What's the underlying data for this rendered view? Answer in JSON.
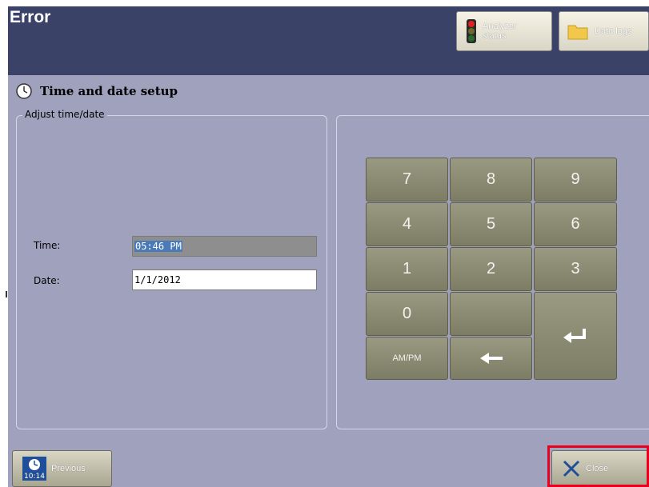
{
  "header": {
    "title": "Error",
    "analyzer_status_label": "Analyzer\nstatus",
    "data_logs_label": "Data logs"
  },
  "section": {
    "title": "Time and date setup"
  },
  "group": {
    "legend": "Adjust time/date",
    "time_label": "Time:",
    "time_value": "05:46 PM",
    "date_label": "Date:",
    "date_value": "1/1/2012"
  },
  "keypad": {
    "keys": [
      "7",
      "8",
      "9",
      "4",
      "5",
      "6",
      "1",
      "2",
      "3",
      "0",
      "",
      "AM/PM"
    ],
    "enter_icon": "enter-arrow-icon",
    "backspace_icon": "left-arrow-icon"
  },
  "footer": {
    "previous_label": "Previous",
    "previous_time": "10:14",
    "close_label": "Close"
  },
  "colors": {
    "header_bg": "#3a4268",
    "panel_bg": "#9fa1bd",
    "key_bg": "#8c8c75",
    "highlight": "#e8001c"
  }
}
